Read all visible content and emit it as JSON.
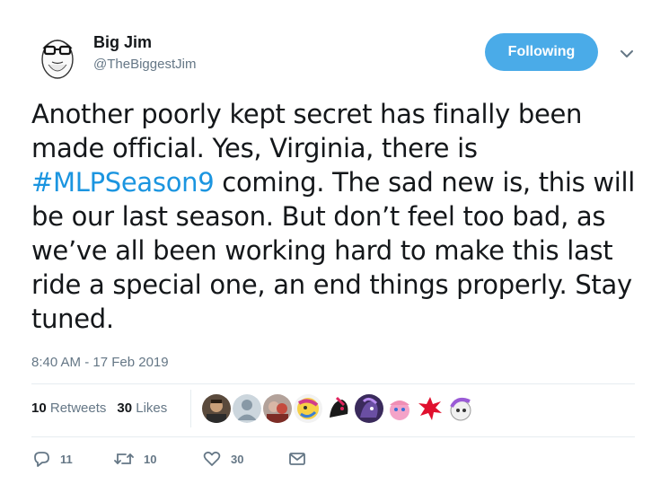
{
  "author": {
    "name": "Big Jim",
    "handle": "@TheBiggestJim"
  },
  "follow_button": {
    "label": "Following"
  },
  "tweet": {
    "text_before": "Another poorly kept secret has finally been made official. Yes, Virginia, there is ",
    "hashtag": "#MLPSeason9",
    "text_after": " coming. The sad new is, this will be our last season. But don’t feel too bad, as we’ve all been working hard to make this last ride a special one, an end things properly. Stay tuned.",
    "timestamp": "8:40 AM - 17 Feb 2019"
  },
  "stats": {
    "retweets_count": "10",
    "retweets_label": "Retweets",
    "likes_count": "30",
    "likes_label": "Likes"
  },
  "actions": {
    "reply_count": "11",
    "retweet_count": "10",
    "like_count": "30"
  },
  "colors": {
    "accent": "#4aabe8",
    "link": "#1b95e0",
    "muted": "#657786",
    "text": "#14171a"
  }
}
